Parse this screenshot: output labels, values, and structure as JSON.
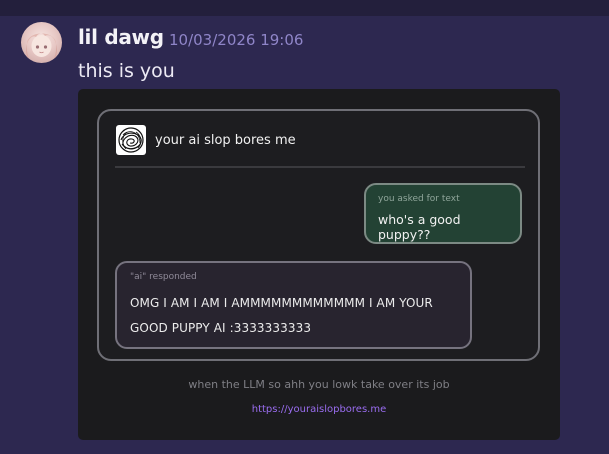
{
  "message": {
    "username": "lil dawg",
    "timestamp": "10/03/2026 19:06",
    "text": "this is you",
    "avatar_icon": "anime-girl-avatar"
  },
  "embed": {
    "title": "your ai slop bores me",
    "logo_icon": "scribble-circle-logo",
    "user_bubble": {
      "label": "you asked for text",
      "text": "who's a good puppy??"
    },
    "ai_bubble": {
      "label": "\"ai\" responded",
      "line1": "OMG I AM I AM I AMMMMMMMMMMMM I AM YOUR",
      "line2": "GOOD PUPPY AI :3333333333"
    },
    "caption": "when the LLM so ahh you lowk take over its job",
    "link": "https://youraislopbores.me"
  },
  "colors": {
    "background": "#2d2850",
    "username": "#f3f2f7",
    "timestamp": "#8f85c8",
    "embed_bg": "#1b1b1d",
    "user_bubble_bg": "#234234",
    "ai_bubble_bg": "#28242f",
    "link": "#9a6df0"
  }
}
